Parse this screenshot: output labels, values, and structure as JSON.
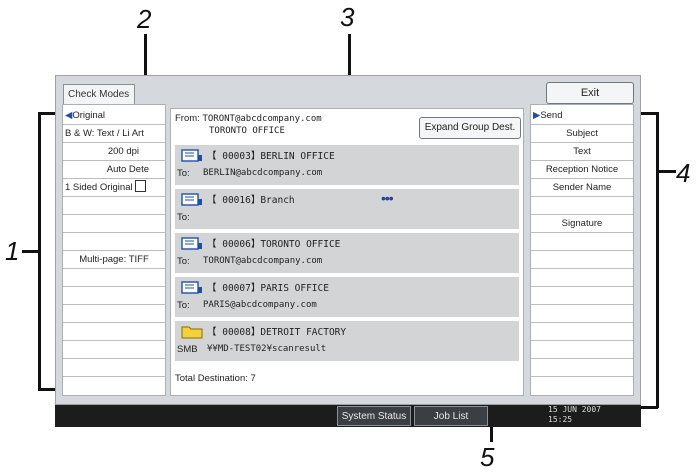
{
  "tab": {
    "label": "Check Modes"
  },
  "exit_label": "Exit",
  "left_column": {
    "rows": [
      "Original",
      "B & W: Text / Li Art",
      "200 dpi",
      "Auto Dete",
      "1 Sided Original",
      "",
      "",
      "Multi-page: TIFF",
      "",
      "",
      "",
      "",
      "",
      "",
      "",
      ""
    ]
  },
  "from": {
    "prefix": "From:",
    "email": "TORONT@abcdcompany.com",
    "name": "TORONTO OFFICE"
  },
  "expand_label": "Expand Group Dest.",
  "destinations": [
    {
      "icon": "fax-icon",
      "title": "【 00003】BERLIN OFFICE",
      "prefix": "To:",
      "detail": "BERLIN@abcdcompany.com"
    },
    {
      "icon": "fax-icon",
      "title": "【 00016】Branch",
      "prefix": "To:",
      "detail": "",
      "group": "•••"
    },
    {
      "icon": "fax-icon",
      "title": "【 00006】TORONTO OFFICE",
      "prefix": "To:",
      "detail": "TORONT@abcdcompany.com"
    },
    {
      "icon": "fax-icon",
      "title": "【 00007】PARIS OFFICE",
      "prefix": "To:",
      "detail": "PARIS@abcdcompany.com"
    },
    {
      "icon": "folder-icon",
      "title": "【 00008】DETROIT FACTORY",
      "prefix": "SMB",
      "detail": "¥¥MD-TEST02¥scanresult"
    }
  ],
  "total": "Total Destination: 7",
  "right_column": {
    "rows": [
      "Send",
      "Subject",
      "Text",
      "Reception Notice",
      "Sender Name",
      "",
      "Signature",
      "",
      "",
      "",
      "",
      "",
      "",
      "",
      "",
      ""
    ]
  },
  "status_bar": {
    "system_status": "System Status",
    "job_list": "Job List",
    "date": "15 JUN  2007",
    "time": "15:25"
  },
  "callouts": [
    "1",
    "2",
    "3",
    "4",
    "5"
  ],
  "colors": {
    "accent_blue": "#1f4fa8",
    "group_icon": "#2a3e9c",
    "folder_yellow": "#f3d13a"
  }
}
